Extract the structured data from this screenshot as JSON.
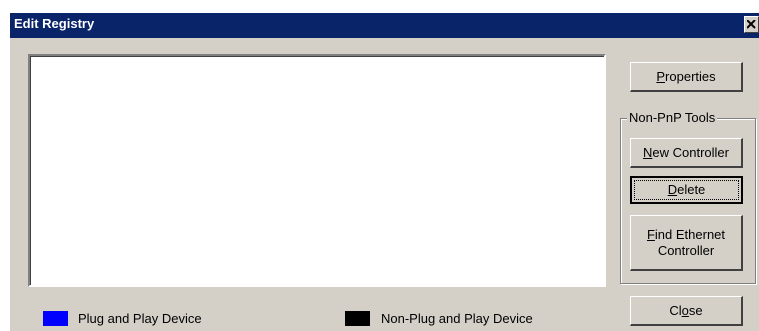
{
  "window": {
    "title": "Edit Registry"
  },
  "buttons": {
    "properties_prefix": "P",
    "properties_rest": "roperties",
    "new_controller_prefix": "N",
    "new_controller_rest": "ew Controller",
    "delete_prefix": "D",
    "delete_rest": "elete",
    "find_prefix": "F",
    "find_rest": "ind Ethernet",
    "find_line2": "Controller",
    "close_pre": "Cl",
    "close_mn": "o",
    "close_post": "se"
  },
  "group": {
    "label": "Non-PnP Tools"
  },
  "legend": [
    {
      "label": "Plug and Play Device",
      "color": "#0000ff"
    },
    {
      "label": "Non-Plug and Play Device",
      "color": "#000000"
    }
  ],
  "colors": {
    "titlebar": "#0a246a",
    "face": "#d4d0c8"
  }
}
